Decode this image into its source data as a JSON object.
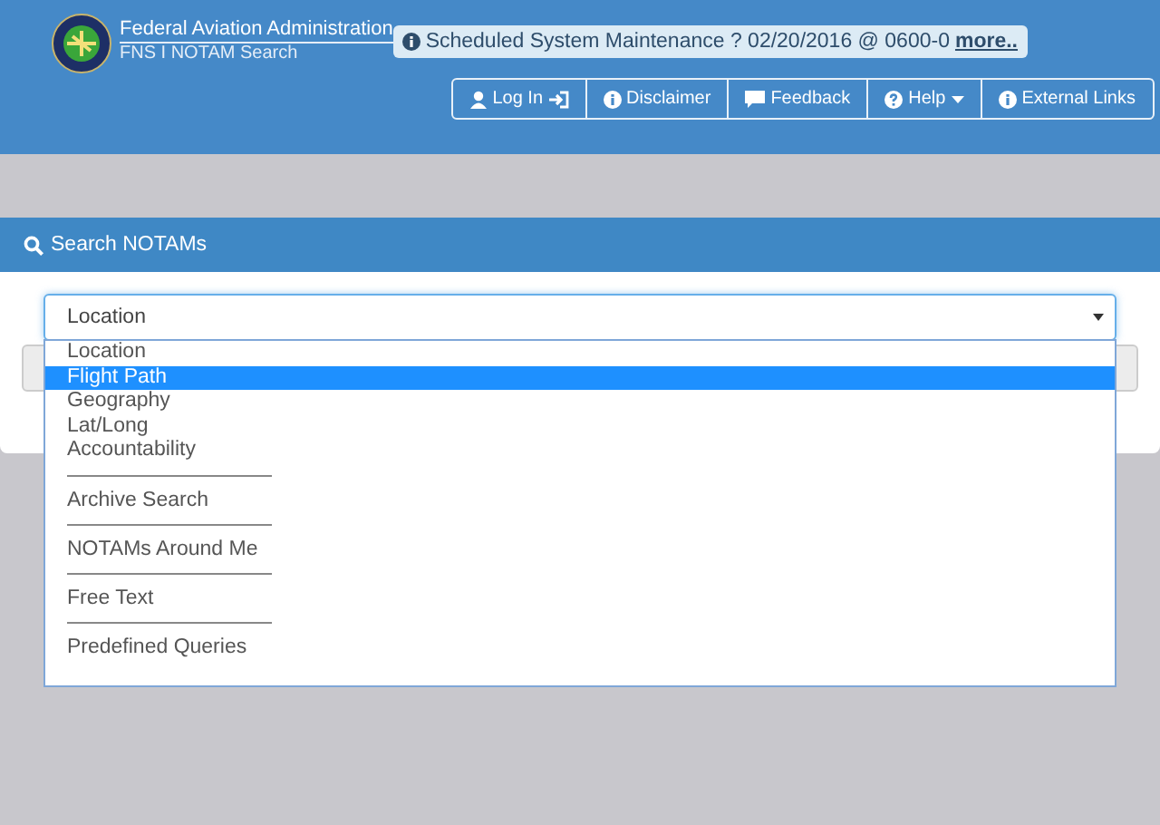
{
  "header": {
    "agency": "Federal Aviation Administration",
    "subtitle": "FNS I NOTAM Search",
    "notice": {
      "text": "Scheduled System Maintenance ? 02/20/2016 @ 0600-0",
      "link": "more.."
    },
    "nav": [
      {
        "label": "Log In"
      },
      {
        "label": "Disclaimer"
      },
      {
        "label": "Feedback"
      },
      {
        "label": "Help"
      },
      {
        "label": "External Links"
      }
    ]
  },
  "panel": {
    "title": "Search NOTAMs",
    "select": {
      "value": "Location",
      "expanded": true,
      "options": [
        {
          "label": "Location",
          "kind": "option",
          "highlighted": false
        },
        {
          "label": "Flight Path",
          "kind": "option",
          "highlighted": true
        },
        {
          "label": "Geography",
          "kind": "option",
          "highlighted": false
        },
        {
          "label": "Lat/Long",
          "kind": "option",
          "highlighted": false
        },
        {
          "label": "Accountability",
          "kind": "option",
          "highlighted": false
        },
        {
          "label": "Archive Search",
          "kind": "section",
          "highlighted": false
        },
        {
          "label": "NOTAMs Around Me",
          "kind": "section",
          "highlighted": false
        },
        {
          "label": "Free Text",
          "kind": "section",
          "highlighted": false
        },
        {
          "label": "Predefined Queries",
          "kind": "section",
          "highlighted": false
        }
      ]
    }
  }
}
